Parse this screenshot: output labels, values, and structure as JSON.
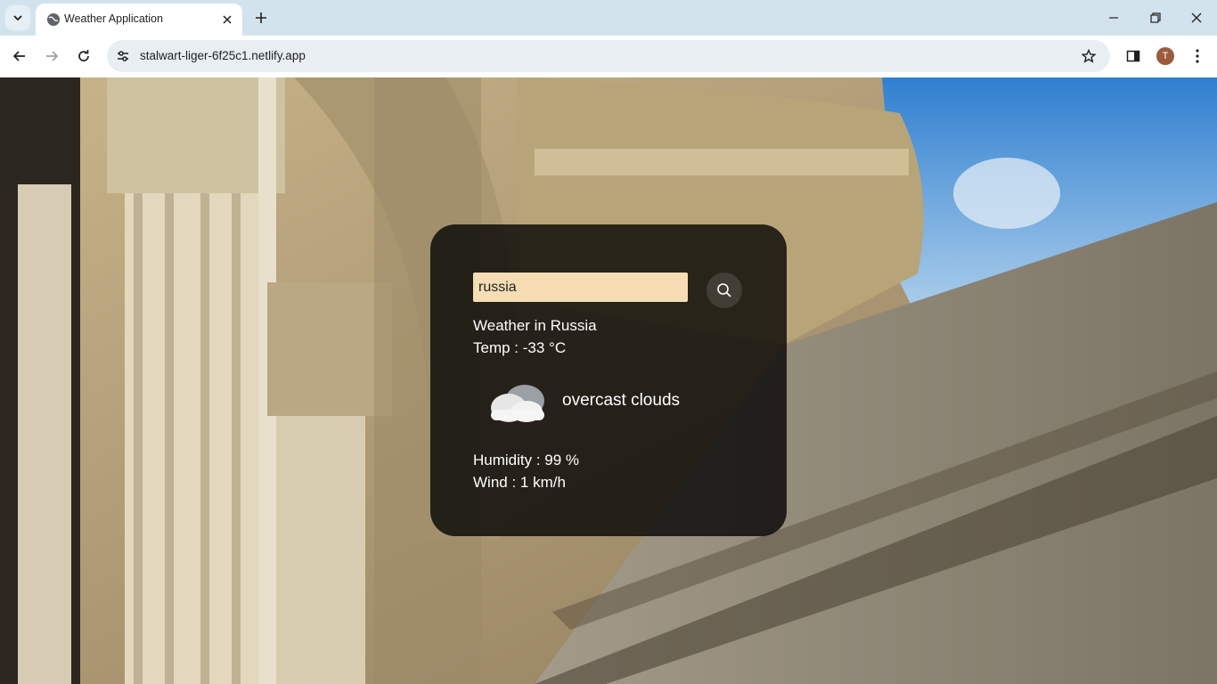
{
  "browser": {
    "tab": {
      "title": "Weather Application"
    },
    "url": "stalwart-liger-6f25c1.netlify.app",
    "profile_initial": "T"
  },
  "weather": {
    "search_value": "russia",
    "city_line": "Weather in Russia",
    "temp_line": "Temp : -33 °C",
    "condition": "overcast clouds",
    "condition_icon": "cloud-icon",
    "humidity_line": "Humidity : 99 %",
    "wind_line": "Wind : 1 km/h"
  },
  "colors": {
    "card_bg": "#000000",
    "input_bg": "#f6ddb4",
    "tabstrip_bg": "#d3e3ee"
  }
}
